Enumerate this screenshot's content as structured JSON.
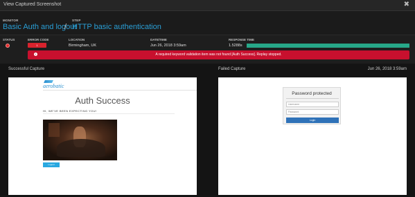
{
  "window": {
    "title": "View Captured Screenshot"
  },
  "header": {
    "monitor_label": "MONITOR",
    "monitor_value": "Basic Auth and logout",
    "separator": "/",
    "step_label": "STEP",
    "step_value": "HTTP basic authentication"
  },
  "info": {
    "status_label": "STATUS",
    "error_label": "ERROR CODE",
    "error_value": "1",
    "location_label": "LOCATION",
    "location_value": "Birmingham, UK",
    "datetime_label": "DATE/TIME",
    "datetime_value": "Jun 26, 2018 3:59am",
    "response_label": "RESPONSE TIME",
    "response_value": "1.5288s",
    "response_fill_fraction": 1.0,
    "alert_message": "A required keyword validation item was not found [Auth Success]. Replay stopped."
  },
  "captures": {
    "successful_label": "Successful Capture",
    "failed_label": "Failed Capture",
    "failed_datetime": "Jun 26, 2018 3:59am"
  },
  "success_page": {
    "logo_text": "aerobatic",
    "heading": "Auth Success",
    "subheading": "HI, WE'VE BEEN EXPECTING YOU!",
    "button": "Logout"
  },
  "failed_page": {
    "title": "Password protected",
    "username_placeholder": "Username",
    "password_placeholder": "Password",
    "login_button": "Login"
  },
  "colors": {
    "accent": "#2a9fd6",
    "error": "#c8102e",
    "response_bar": "#27a889"
  }
}
